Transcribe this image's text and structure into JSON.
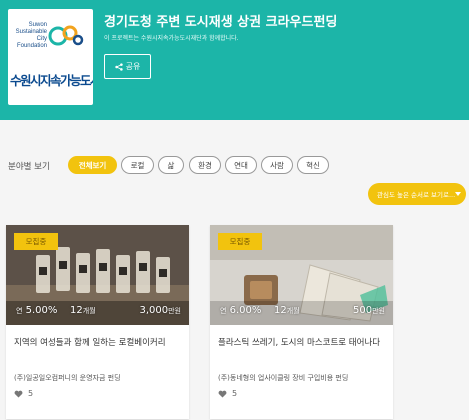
{
  "header": {
    "logo_en_lines": [
      "Suwon",
      "Sustainable",
      "City Foundation"
    ],
    "logo_ko": "수원시지속가능도시재단",
    "title": "경기도청 주변 도시재생 상권 크라우드펀딩",
    "subtitle": "이 프로젝트는 수원시지속가능도시재단과 함께합니다.",
    "share_label": "공유"
  },
  "filters": {
    "label": "분야별 보기",
    "chips": [
      {
        "label": "전체보기",
        "active": true
      },
      {
        "label": "로컬"
      },
      {
        "label": "삶"
      },
      {
        "label": "환경"
      },
      {
        "label": "연대"
      },
      {
        "label": "사람"
      },
      {
        "label": "혁신"
      }
    ]
  },
  "sort": {
    "label": "관심도 높은 순서로 보기로..."
  },
  "cards": [
    {
      "badge": "모집중",
      "rate_prefix": "연",
      "rate": "5.00%",
      "term": "12",
      "term_unit": "개월",
      "amount": "3,000",
      "amount_unit": "만원",
      "title": "지역의 여성들과 함께 일하는 로컬베이커리",
      "subtitle": "(주)일공일오컴퍼니의 운영자금 펀딩",
      "likes": "5"
    },
    {
      "badge": "모집중",
      "rate_prefix": "연",
      "rate": "6.00%",
      "term": "12",
      "term_unit": "개월",
      "amount": "500",
      "amount_unit": "만원",
      "title": "플라스틱 쓰레기, 도시의 마스코트로 태어나다",
      "subtitle": "(주)동네형의 업사이클링 장비 구입비용 펀딩",
      "likes": "5"
    }
  ],
  "colors": {
    "hero": "#1cb5a8",
    "accent": "#f2c30e",
    "logo_blue": "#0b4a8f"
  }
}
